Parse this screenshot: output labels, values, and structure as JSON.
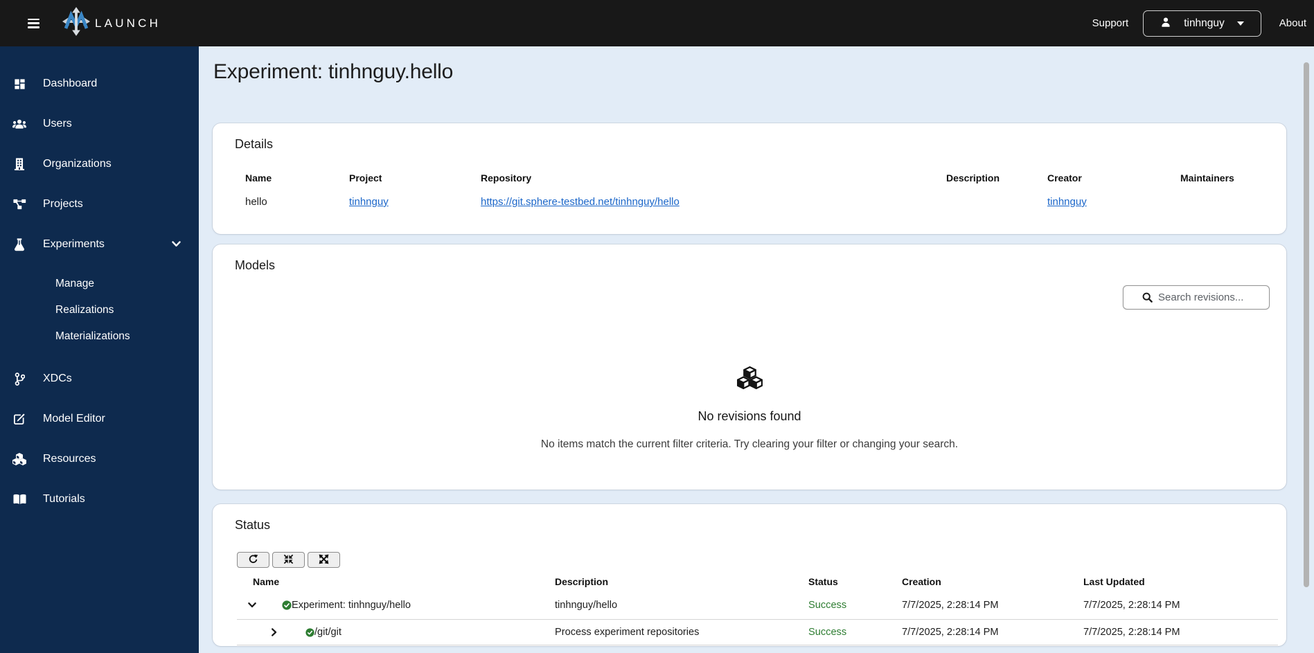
{
  "topbar": {
    "brand": "LAUNCH",
    "support": "Support",
    "username": "tinhnguy",
    "about": "About"
  },
  "page": {
    "title": "Experiment: tinhnguy.hello"
  },
  "sidebar": {
    "items": [
      {
        "label": "Dashboard"
      },
      {
        "label": "Users"
      },
      {
        "label": "Organizations"
      },
      {
        "label": "Projects"
      },
      {
        "label": "Experiments"
      },
      {
        "label": "XDCs"
      },
      {
        "label": "Model Editor"
      },
      {
        "label": "Resources"
      },
      {
        "label": "Tutorials"
      }
    ],
    "experiments_children": [
      {
        "label": "Manage"
      },
      {
        "label": "Realizations"
      },
      {
        "label": "Materializations"
      }
    ]
  },
  "details": {
    "title": "Details",
    "headers": [
      "Name",
      "Project",
      "Repository",
      "Description",
      "Creator",
      "Maintainers"
    ],
    "row": {
      "name": "hello",
      "project": "tinhnguy",
      "repository": "https://git.sphere-testbed.net/tinhnguy/hello",
      "description": "",
      "creator": "tinhnguy",
      "maintainers": ""
    }
  },
  "models": {
    "title": "Models",
    "search_placeholder": "Search revisions...",
    "empty_title": "No revisions found",
    "empty_message": "No items match the current filter criteria. Try clearing your filter or changing your search."
  },
  "status": {
    "title": "Status",
    "headers": [
      "Name",
      "Description",
      "Status",
      "Creation",
      "Last Updated"
    ],
    "rows": [
      {
        "name": "Experiment: tinhnguy/hello",
        "description": "tinhnguy/hello",
        "status": "Success",
        "creation": "7/7/2025, 2:28:14 PM",
        "last_updated": "7/7/2025, 2:28:14 PM",
        "state": "expanded"
      },
      {
        "name": "/git/git",
        "description": "Process experiment repositories",
        "status": "Success",
        "creation": "7/7/2025, 2:28:14 PM",
        "last_updated": "7/7/2025, 2:28:14 PM",
        "state": "collapsed"
      }
    ]
  },
  "icons": {
    "topbar": [
      "menu-icon",
      "launch-logo-icon",
      "user-icon",
      "caret-down-icon"
    ],
    "sidebar": [
      "dashboard-icon",
      "users-icon",
      "organizations-icon",
      "projects-icon",
      "flask-icon",
      "chevron-down-icon",
      "code-branch-icon",
      "edit-icon",
      "cubes-icon",
      "book-icon"
    ],
    "models": [
      "search-icon",
      "cubes-icon"
    ],
    "status": [
      "refresh-icon",
      "collapse-icon",
      "expand-icon",
      "chevron-down-icon",
      "chevron-right-icon",
      "check-circle-icon"
    ]
  },
  "colors": {
    "topbar_bg": "#181818",
    "sidebar_bg": "#0e2a4e",
    "page_bg": "#e2ecf7",
    "card_bg": "#ffffff",
    "link_blue": "#1b66c9",
    "success_green": "#2e7d32",
    "highlight_row": "#dce9f7"
  }
}
